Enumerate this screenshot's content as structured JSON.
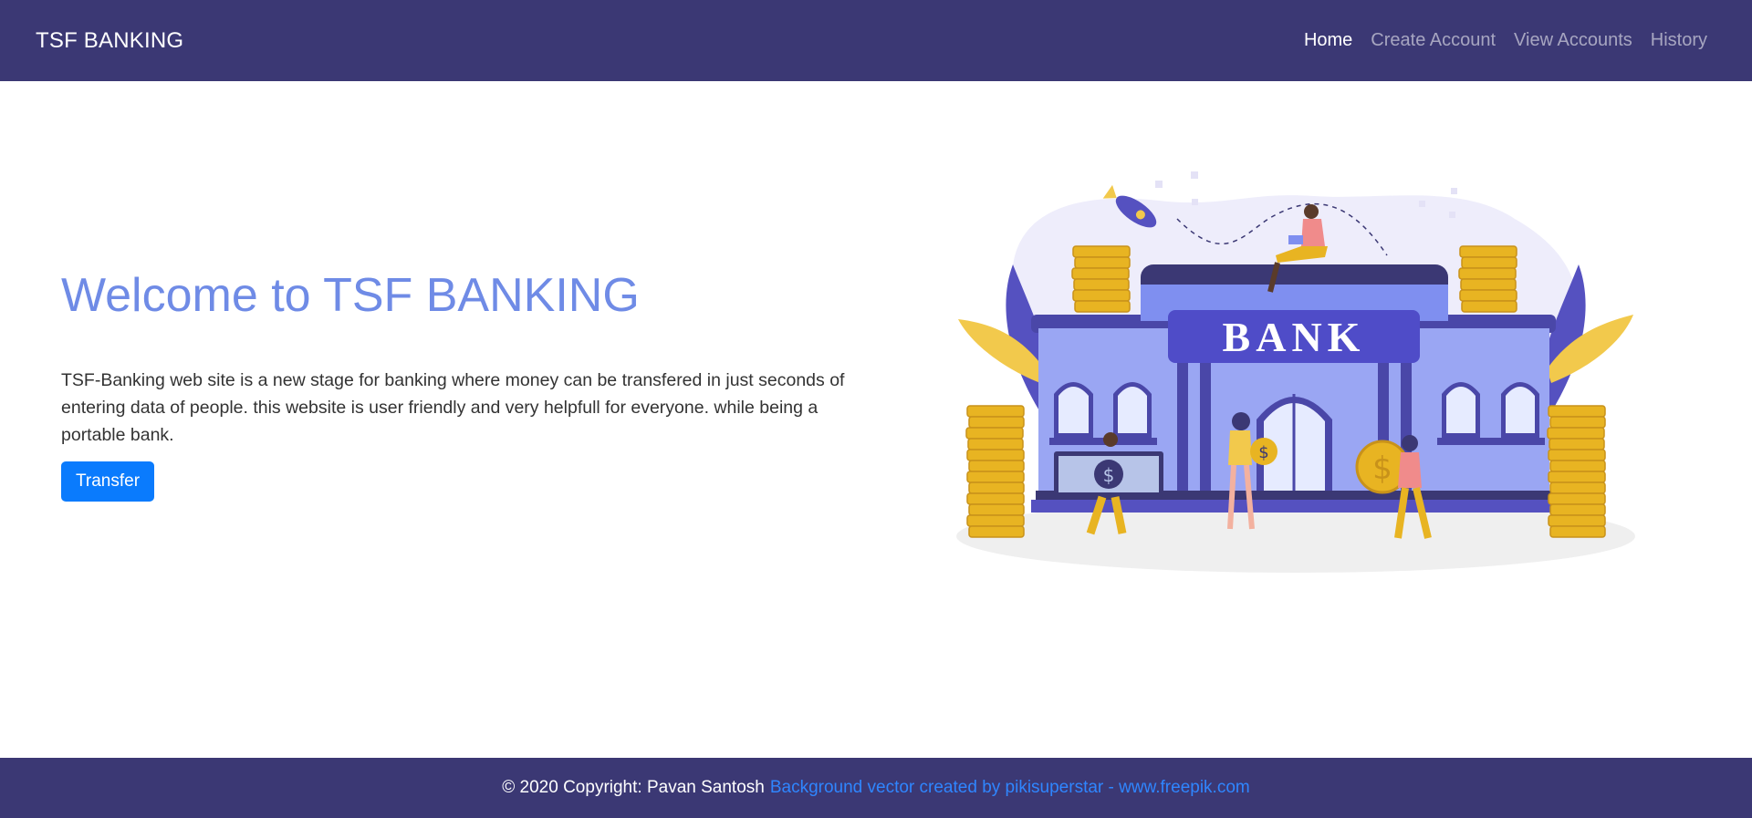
{
  "header": {
    "brand": "TSF BANKING",
    "nav": [
      {
        "label": "Home",
        "active": true
      },
      {
        "label": "Create Account",
        "active": false
      },
      {
        "label": "View Accounts",
        "active": false
      },
      {
        "label": "History",
        "active": false
      }
    ]
  },
  "hero": {
    "title": "Welcome to TSF BANKING",
    "description": "TSF-Banking web site is a new stage for banking where money can be transfered in just seconds of entering data of people. this website is user friendly and very helpfull for everyone. while being a portable bank.",
    "button_label": "Transfer"
  },
  "illustration": {
    "sign_text": "BANK",
    "coin_symbol": "$"
  },
  "footer": {
    "copyright": "© 2020 Copyright: Pavan Santosh",
    "credit_link": "Background vector created by pikisuperstar - www.freepik.com"
  },
  "colors": {
    "navbar_bg": "#3b3874",
    "title": "#6f8be6",
    "button": "#0a7bfd",
    "link": "#2f86ff"
  }
}
